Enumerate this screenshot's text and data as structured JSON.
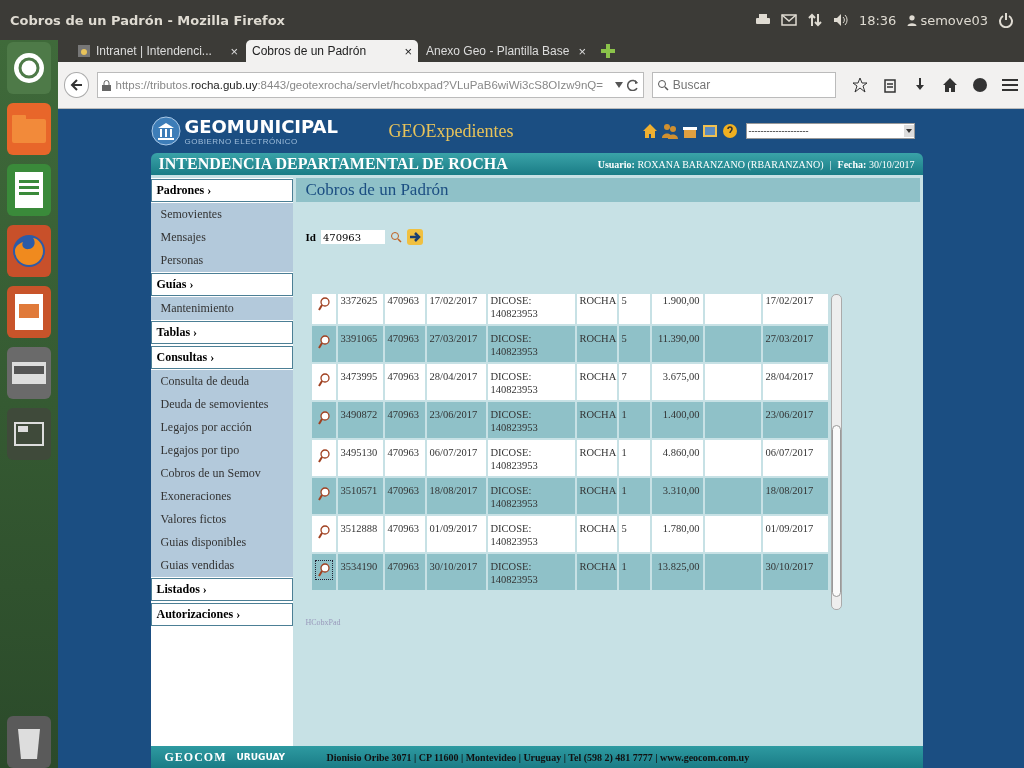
{
  "panel": {
    "title": "Cobros de un Padrón - Mozilla Firefox",
    "time": "18:36",
    "user": "semove03"
  },
  "tabs": [
    {
      "label": "Intranet | Intendenci...",
      "selected": false,
      "close": "×"
    },
    {
      "label": "Cobros de un Padrón",
      "selected": true,
      "close": "×"
    },
    {
      "label": "Anexo Geo - Plantilla Base",
      "selected": false,
      "close": "×"
    }
  ],
  "address": {
    "url": "https://tributos.**rocha.gub.uy**:8443/geotexrocha/servlet/hcobxpad?VLuPaB6wiWi3cS8OIzw9nQ="
  },
  "search": {
    "placeholder": "Buscar"
  },
  "site": {
    "logo": "GEOMUNICIPAL",
    "logo_sub": "GOBIERNO ELECTRÓNICO",
    "app": "GEOExpedientes",
    "select": "--------------------"
  },
  "banner": {
    "title": "INTENDENCIA DEPARTAMENTAL DE ROCHA",
    "user_label": "Usuario:",
    "user": "ROXANA BARANZANO (RBARANZANO)",
    "sep": "|",
    "date_label": "Fecha:",
    "date": "30/10/2017"
  },
  "sidebar": [
    {
      "label": "Padrones ›",
      "children": [
        {
          "label": "Semovientes"
        },
        {
          "label": "Mensajes"
        },
        {
          "label": "Personas"
        }
      ]
    },
    {
      "label": "Guías ›",
      "children": [
        {
          "label": "Mantenimiento"
        }
      ]
    },
    {
      "label": "Tablas ›"
    },
    {
      "label": "Consultas ›",
      "children": [
        {
          "label": "Consulta de deuda"
        },
        {
          "label": "Deuda de semovientes"
        },
        {
          "label": "Legajos por acción"
        },
        {
          "label": "Legajos por tipo"
        },
        {
          "label": "Cobros de un Semov"
        },
        {
          "label": "Exoneraciones"
        },
        {
          "label": "Valores fictos"
        },
        {
          "label": "Guias disponibles"
        },
        {
          "label": "Guias vendidas"
        }
      ]
    },
    {
      "label": "Listados ›"
    },
    {
      "label": "Autorizaciones ›"
    }
  ],
  "page_title": "Cobros de un Padrón",
  "id_field": {
    "label": "Id",
    "value": "470963"
  },
  "rows": [
    {
      "cells": [
        "3372625",
        "470963",
        "17/02/2017",
        "DICOSE: 140823953",
        "ROCHA",
        "5",
        "1.900,00",
        "",
        "17/02/2017"
      ],
      "focused": false
    },
    {
      "cells": [
        "3391065",
        "470963",
        "27/03/2017",
        "DICOSE: 140823953",
        "ROCHA",
        "5",
        "11.390,00",
        "",
        "27/03/2017"
      ],
      "focused": false
    },
    {
      "cells": [
        "3473995",
        "470963",
        "28/04/2017",
        "DICOSE: 140823953",
        "ROCHA",
        "7",
        "3.675,00",
        "",
        "28/04/2017"
      ],
      "focused": false
    },
    {
      "cells": [
        "3490872",
        "470963",
        "23/06/2017",
        "DICOSE: 140823953",
        "ROCHA",
        "1",
        "1.400,00",
        "",
        "23/06/2017"
      ],
      "focused": false
    },
    {
      "cells": [
        "3495130",
        "470963",
        "06/07/2017",
        "DICOSE: 140823953",
        "ROCHA",
        "1",
        "4.860,00",
        "",
        "06/07/2017"
      ],
      "focused": false
    },
    {
      "cells": [
        "3510571",
        "470963",
        "18/08/2017",
        "DICOSE: 140823953",
        "ROCHA",
        "1",
        "3.310,00",
        "",
        "18/08/2017"
      ],
      "focused": false
    },
    {
      "cells": [
        "3512888",
        "470963",
        "01/09/2017",
        "DICOSE: 140823953",
        "ROCHA",
        "5",
        "1.780,00",
        "",
        "01/09/2017"
      ],
      "focused": false
    },
    {
      "cells": [
        "3534190",
        "470963",
        "30/10/2017",
        "DICOSE: 140823953",
        "ROCHA",
        "1",
        "13.825,00",
        "",
        "30/10/2017"
      ],
      "focused": true
    }
  ],
  "program_name": "HCobxPad",
  "footer": {
    "brand": "GEOCOM",
    "country": "URUGUAY",
    "address": "Dionisio Oribe 3071 | CP 11600 | Montevideo | Uruguay | Tel (598 2) 481 7777 | www.geocom.com.uy"
  }
}
